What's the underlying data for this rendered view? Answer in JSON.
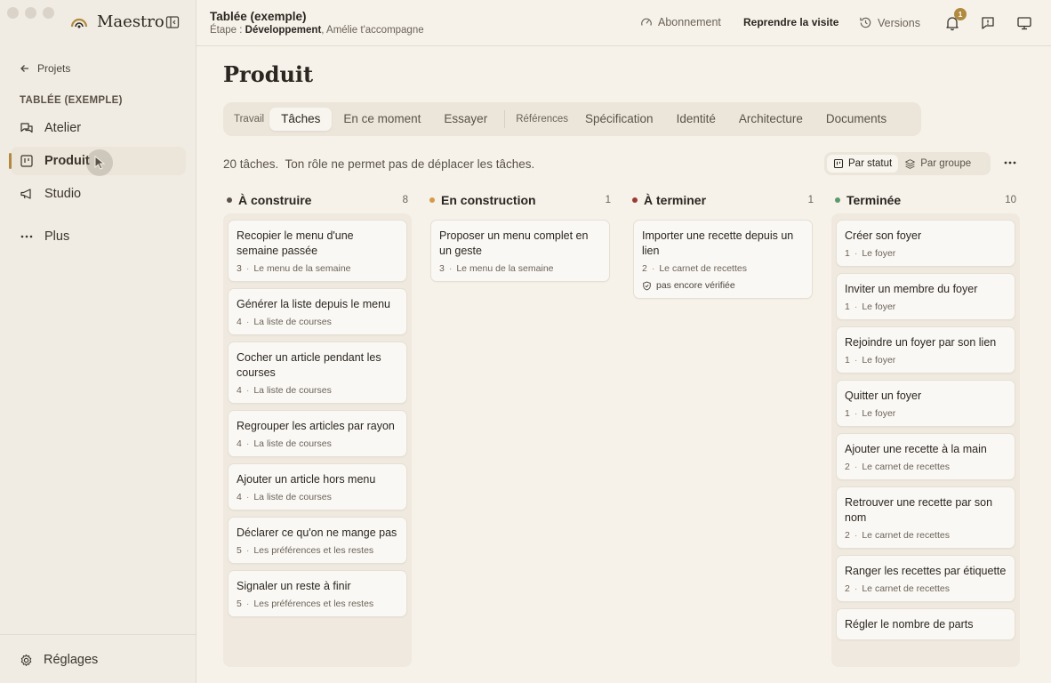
{
  "app": {
    "name": "Maestro"
  },
  "sidebar": {
    "back_label": "Projets",
    "section_title": "TABLÉE (EXEMPLE)",
    "items": [
      {
        "label": "Atelier"
      },
      {
        "label": "Produit"
      },
      {
        "label": "Studio"
      },
      {
        "label": "Plus"
      }
    ],
    "settings_label": "Réglages"
  },
  "header": {
    "title": "Tablée (exemple)",
    "subtitle_prefix": "Étape : ",
    "subtitle_stage": "Développement",
    "subtitle_rest": ", Amélie t'accompagne",
    "subscription": "Abonnement",
    "resume": "Reprendre la visite",
    "versions": "Versions",
    "notification_count": "1"
  },
  "main": {
    "page_title": "Produit",
    "tabs": [
      {
        "label": "Travail"
      },
      {
        "label": "Tâches"
      },
      {
        "label": "En ce moment"
      },
      {
        "label": "Essayer"
      },
      {
        "label": "Références"
      },
      {
        "label": "Spécification"
      },
      {
        "label": "Identité"
      },
      {
        "label": "Architecture"
      },
      {
        "label": "Documents"
      }
    ],
    "info": "20 tâches.  Ton rôle ne permet pas de déplacer les tâches.",
    "view_by_status": "Par statut",
    "view_by_group": "Par groupe"
  },
  "colors": {
    "accent": "#b08a3e",
    "todo": "#5a5248",
    "in_progress": "#d69a4a",
    "finishing": "#9b3b34",
    "done": "#5c9a6b"
  },
  "columns": [
    {
      "title": "À construire",
      "count": "8",
      "cards": [
        {
          "title": "Recopier le menu d'une semaine passée",
          "num": "3",
          "group": "Le menu de la semaine"
        },
        {
          "title": "Générer la liste depuis le menu",
          "num": "4",
          "group": "La liste de courses"
        },
        {
          "title": "Cocher un article pendant les courses",
          "num": "4",
          "group": "La liste de courses"
        },
        {
          "title": "Regrouper les articles par rayon",
          "num": "4",
          "group": "La liste de courses"
        },
        {
          "title": "Ajouter un article hors menu",
          "num": "4",
          "group": "La liste de courses"
        },
        {
          "title": "Déclarer ce qu'on ne mange pas",
          "num": "5",
          "group": "Les préférences et les restes"
        },
        {
          "title": "Signaler un reste à finir",
          "num": "5",
          "group": "Les préférences et les restes"
        }
      ]
    },
    {
      "title": "En construction",
      "count": "1",
      "cards": [
        {
          "title": "Proposer un menu complet en un geste",
          "num": "3",
          "group": "Le menu de la semaine"
        }
      ]
    },
    {
      "title": "À terminer",
      "count": "1",
      "cards": [
        {
          "title": "Importer une recette depuis un lien",
          "num": "2",
          "group": "Le carnet de recettes",
          "flag": "pas encore vérifiée"
        }
      ]
    },
    {
      "title": "Terminée",
      "count": "10",
      "cards": [
        {
          "title": "Créer son foyer",
          "num": "1",
          "group": "Le foyer"
        },
        {
          "title": "Inviter un membre du foyer",
          "num": "1",
          "group": "Le foyer"
        },
        {
          "title": "Rejoindre un foyer par son lien",
          "num": "1",
          "group": "Le foyer"
        },
        {
          "title": "Quitter un foyer",
          "num": "1",
          "group": "Le foyer"
        },
        {
          "title": "Ajouter une recette à la main",
          "num": "2",
          "group": "Le carnet de recettes"
        },
        {
          "title": "Retrouver une recette par son nom",
          "num": "2",
          "group": "Le carnet de recettes"
        },
        {
          "title": "Ranger les recettes par étiquette",
          "num": "2",
          "group": "Le carnet de recettes"
        },
        {
          "title": "Régler le nombre de parts",
          "num": "",
          "group": ""
        }
      ]
    }
  ]
}
